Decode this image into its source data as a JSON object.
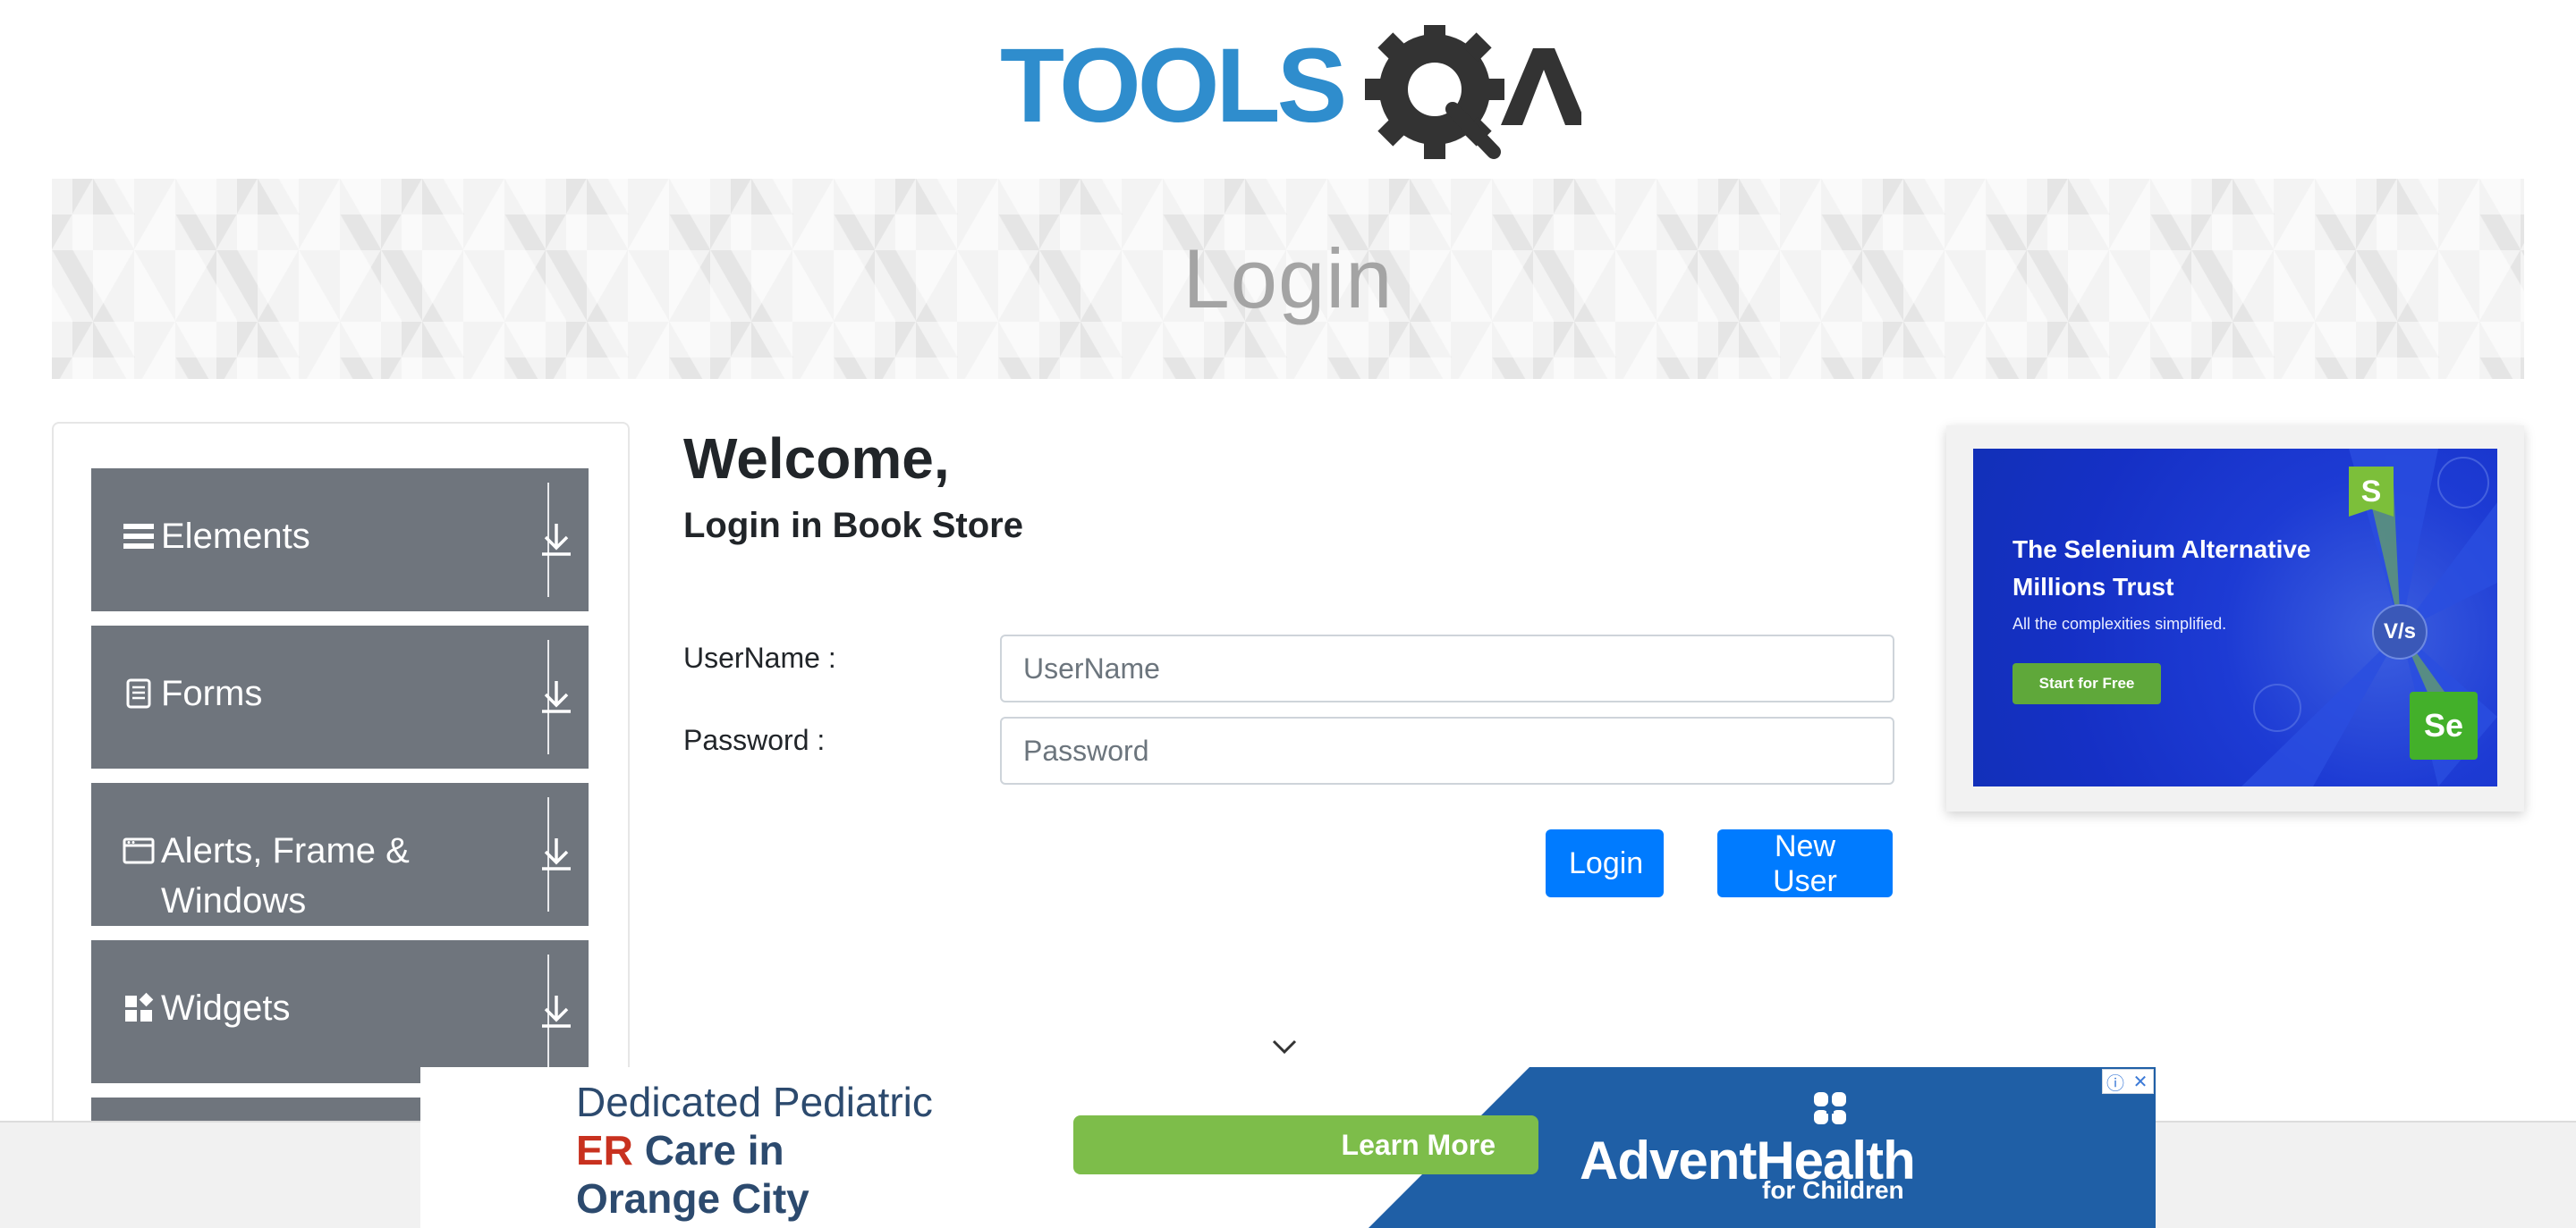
{
  "logo": {
    "alt_text": "TOOLSQA"
  },
  "banner": {
    "title": "Login"
  },
  "left_nav": {
    "groups": [
      {
        "label": "Elements",
        "icon": "hamburger-icon"
      },
      {
        "label": "Forms",
        "icon": "document-icon"
      },
      {
        "label": "Alerts, Frame & Windows",
        "icon": "window-icon"
      },
      {
        "label": "Widgets",
        "icon": "widgets-icon"
      }
    ],
    "expand_icon": "download-arrow-icon"
  },
  "main": {
    "welcome": "Welcome,",
    "subtitle": "Login in Book Store",
    "username_label": "UserName :",
    "username_placeholder": "UserName",
    "username_value": "",
    "password_label": "Password :",
    "password_placeholder": "Password",
    "password_value": "",
    "login_button": "Login",
    "new_user_button": "New User"
  },
  "side_ad": {
    "title": "The Selenium Alternative Millions Trust",
    "subtitle": "All the complexities simplified.",
    "cta": "Start for Free",
    "badge_left": "S",
    "badge_right": "Se",
    "vs": "V/s"
  },
  "bottom_ad": {
    "line1": "Dedicated Pediatric",
    "line2_highlight": "ER",
    "line2_rest": "Care in",
    "line3": "Orange City",
    "cta": "Learn More",
    "brand": "AdventHealth",
    "brand_sub": "for Children",
    "adchoices_info": "ⓘ",
    "adchoices_close": "✕"
  },
  "colors": {
    "nav_group_bg": "#6f757d",
    "primary_button": "#007bff",
    "banner_title": "#a4a4a4",
    "logo_blue": "#2f8dcd",
    "logo_dark": "#333333"
  }
}
